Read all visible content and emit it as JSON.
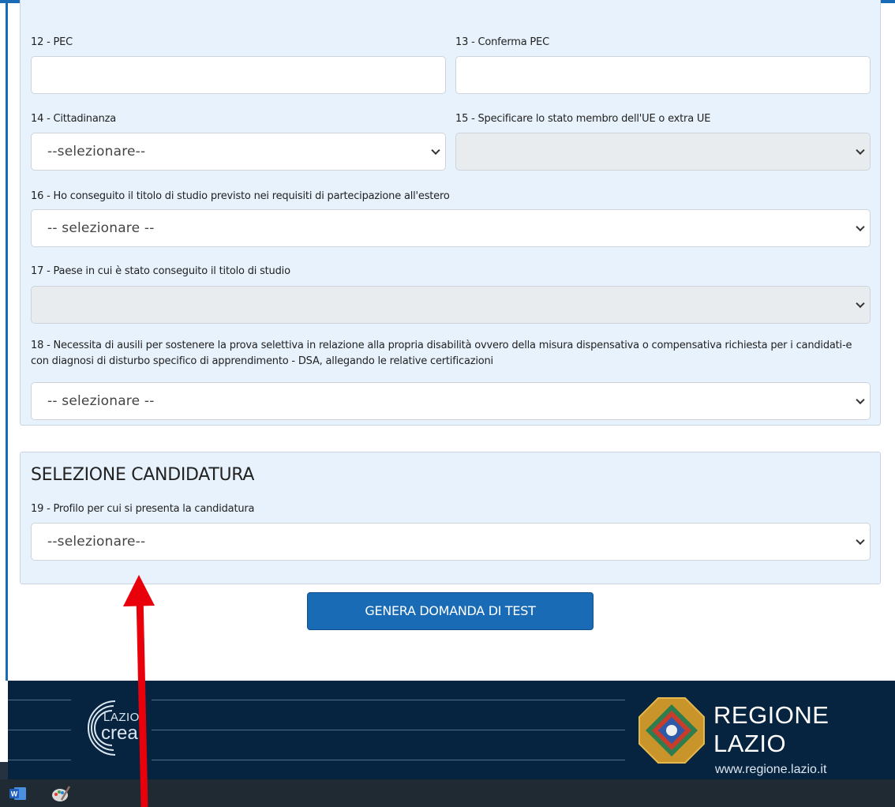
{
  "form": {
    "pec_label": "12 - PEC",
    "pec_value": "",
    "conferma_pec_label": "13 - Conferma PEC",
    "conferma_pec_value": "",
    "cittadinanza_label": "14 - Cittadinanza",
    "cittadinanza_value": "--selezionare--",
    "stato_membro_label": "15 - Specificare lo stato membro dell'UE o extra UE",
    "stato_membro_value": "",
    "titolo_estero_label": "16 - Ho conseguito il titolo di studio previsto nei requisiti di partecipazione all'estero",
    "titolo_estero_value": "-- selezionare --",
    "paese_titolo_label": "17 - Paese in cui è stato conseguito il titolo di studio",
    "paese_titolo_value": "",
    "ausili_label": "18 - Necessita di ausili per sostenere la prova selettiva in relazione alla propria disabilità ovvero della misura dispensativa o compensativa richiesta per i candidati-e con diagnosi di disturbo specifico di apprendimento - DSA, allegando le relative certificazioni",
    "ausili_value": "-- selezionare --"
  },
  "candidatura": {
    "title": "SELEZIONE CANDIDATURA",
    "profilo_label": "19 - Profilo per cui si presenta la candidatura",
    "profilo_value": "--selezionare--"
  },
  "actions": {
    "genera_label": "GENERA DOMANDA DI TEST"
  },
  "footer": {
    "lazio_small": "LAZIO",
    "lazio_big": "crea",
    "regione_line1": "REGIONE",
    "regione_line2": "LAZIO",
    "regione_url": "www.regione.lazio.it"
  },
  "taskbar": {
    "icons": [
      "word-icon",
      "paint-icon"
    ]
  },
  "colors": {
    "primary": "#1a6bb5",
    "panel_bg": "#e8f2fc",
    "footer_bg": "#06243f",
    "annotation_arrow": "#e8000b"
  }
}
